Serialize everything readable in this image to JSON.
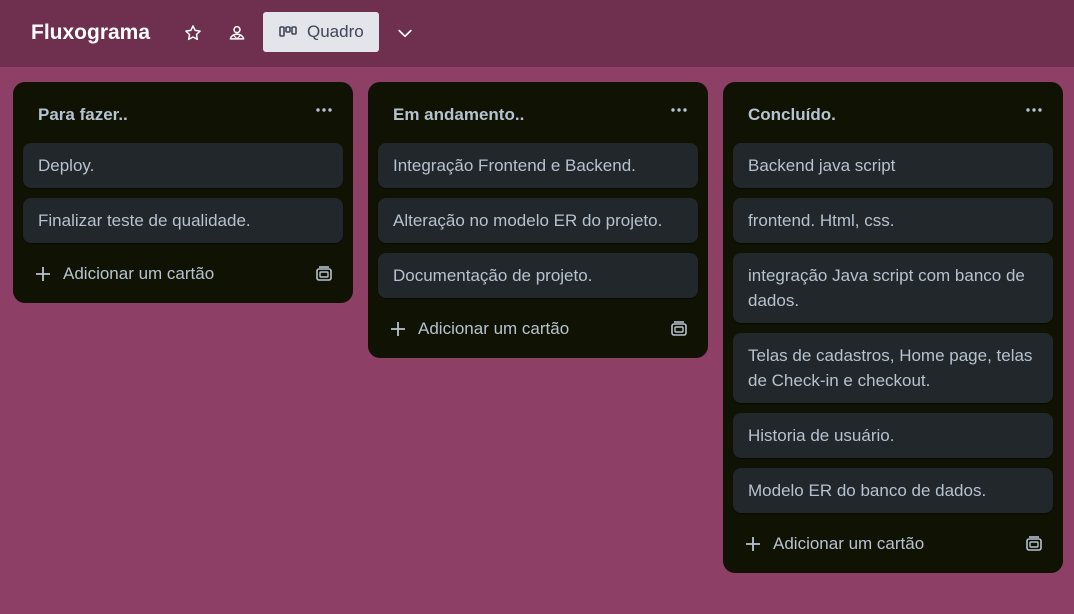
{
  "header": {
    "board_title": "Fluxograma",
    "view_label": "Quadro",
    "icons": [
      "star-icon",
      "members-icon",
      "board-view-icon",
      "chevron-down-icon"
    ]
  },
  "lists": [
    {
      "title": "Para fazer..",
      "cards": [
        "Deploy.",
        "Finalizar teste de qualidade."
      ],
      "add_label": "Adicionar um cartão"
    },
    {
      "title": "Em andamento..",
      "cards": [
        "Integração Frontend e Backend.",
        "Alteração no modelo ER do projeto.",
        "Documentação de projeto."
      ],
      "add_label": "Adicionar um cartão"
    },
    {
      "title": "Concluído.",
      "cards": [
        "Backend java script",
        "frontend. Html, css.",
        "integração Java script com banco de dados.",
        "Telas de cadastros, Home page, telas de Check-in e checkout.",
        "Historia de usuário.",
        "Modelo ER do banco de dados."
      ],
      "add_label": "Adicionar um cartão"
    }
  ],
  "colors": {
    "board_background": "#8e3f66",
    "header_background": "#6f2f4f",
    "list_background": "#101204",
    "card_background": "#22272b",
    "text": "#b6c2cf"
  }
}
